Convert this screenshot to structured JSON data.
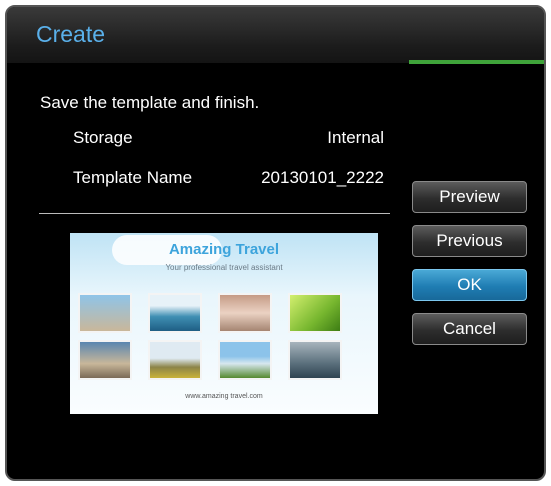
{
  "dialog": {
    "title": "Create",
    "subtitle": "Save the template and finish.",
    "colors": {
      "title": "#5ab0ea",
      "progress": "#3fa33a",
      "selected_button": "#1f7db3"
    }
  },
  "fields": [
    {
      "label": "Storage",
      "value": "Internal"
    },
    {
      "label": "Template Name",
      "value": "20130101_2222"
    }
  ],
  "template_preview": {
    "title": "Amazing Travel",
    "subtitle": "Your professional travel assistant",
    "url": "www.amazing travel.com"
  },
  "buttons": [
    {
      "label": "Preview",
      "selected": false
    },
    {
      "label": "Previous",
      "selected": false
    },
    {
      "label": "OK",
      "selected": true
    },
    {
      "label": "Cancel",
      "selected": false
    }
  ]
}
